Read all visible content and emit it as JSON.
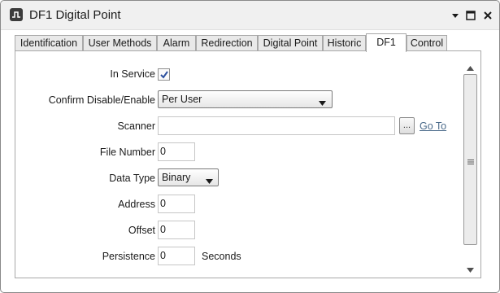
{
  "window": {
    "title": "DF1 Digital Point",
    "app_icon": "digital-point-icon",
    "controls": [
      "menu-arrow-icon",
      "maximize-icon",
      "close-icon"
    ]
  },
  "tabs": [
    {
      "label": "Identification",
      "active": false
    },
    {
      "label": "User Methods",
      "active": false
    },
    {
      "label": "Alarm",
      "active": false
    },
    {
      "label": "Redirection",
      "active": false
    },
    {
      "label": "Digital Point",
      "active": false
    },
    {
      "label": "Historic",
      "active": false
    },
    {
      "label": "DF1",
      "active": true
    },
    {
      "label": "Control",
      "active": false
    }
  ],
  "form": {
    "in_service": {
      "label": "In Service",
      "checked": true
    },
    "confirm": {
      "label": "Confirm Disable/Enable",
      "value": "Per User"
    },
    "scanner": {
      "label": "Scanner",
      "value": "",
      "browse_label": "...",
      "goto_label": "Go To"
    },
    "file_number": {
      "label": "File Number",
      "value": "0"
    },
    "data_type": {
      "label": "Data Type",
      "value": "Binary"
    },
    "address": {
      "label": "Address",
      "value": "0"
    },
    "offset": {
      "label": "Offset",
      "value": "0"
    },
    "persistence": {
      "label": "Persistence",
      "value": "0",
      "unit": "Seconds"
    }
  },
  "colors": {
    "link": "#4a6a8a",
    "tab_border": "#a8a8a8",
    "titlebar": "#f0f0f0"
  }
}
